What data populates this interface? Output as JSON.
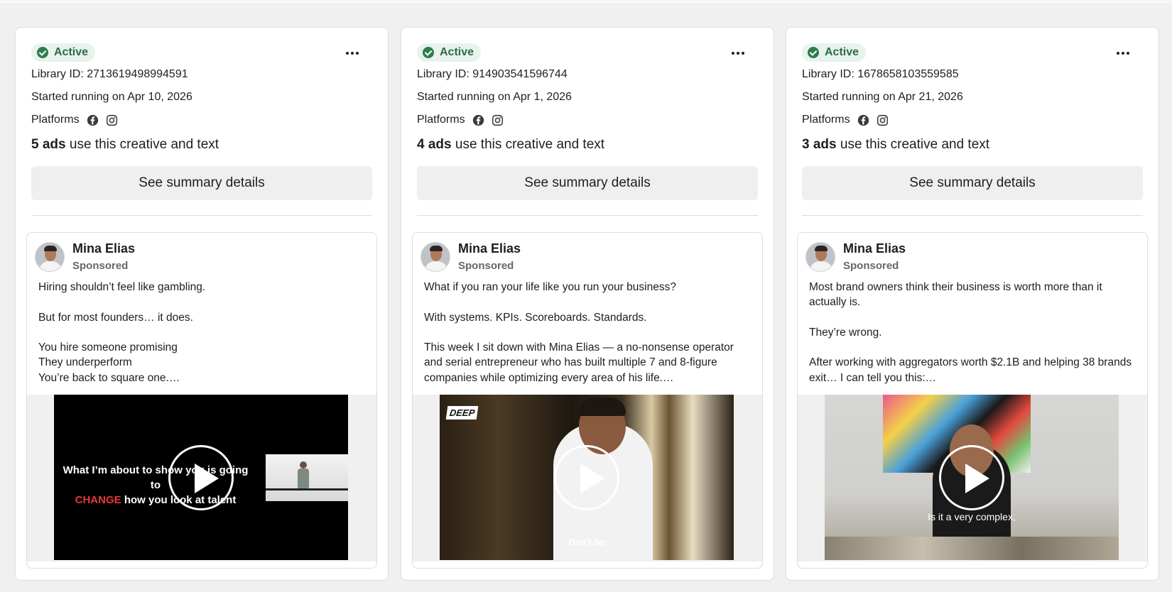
{
  "cards": [
    {
      "status": "Active",
      "library_id": "Library ID: 2713619498994591",
      "started": "Started running on Apr 10, 2026",
      "platforms_label": "Platforms",
      "ads_count": "5 ads",
      "ads_suffix": " use this creative and text",
      "summary_button": "See summary details",
      "advertiser": "Mina Elias",
      "sponsored": "Sponsored",
      "text_lines": [
        "Hiring shouldn’t feel like gambling.",
        "",
        "But for most founders… it does.",
        "",
        "You hire someone promising",
        "They underperform",
        "You’re back to square one.…"
      ],
      "video_caption_1": "What I’m about to show you is going to",
      "video_caption_2a": "CHANGE",
      "video_caption_2b": " how you look at talent"
    },
    {
      "status": "Active",
      "library_id": "Library ID: 914903541596744",
      "started": "Started running on Apr 1, 2026",
      "platforms_label": "Platforms",
      "ads_count": "4 ads",
      "ads_suffix": " use this creative and text",
      "summary_button": "See summary details",
      "advertiser": "Mina Elias",
      "sponsored": "Sponsored",
      "text_lines": [
        "What if you ran your life like you run your business?",
        "",
        "With systems. KPIs. Scoreboards. Standards.",
        "",
        "This week I sit down with Mina Elias — a no-nonsense operator and serial entrepreneur who has built multiple 7 and 8-figure companies while optimizing every area of his life.…"
      ],
      "video_logo": "DEEP",
      "video_caption": "Don't be"
    },
    {
      "status": "Active",
      "library_id": "Library ID: 1678658103559585",
      "started": "Started running on Apr 21, 2026",
      "platforms_label": "Platforms",
      "ads_count": "3 ads",
      "ads_suffix": " use this creative and text",
      "summary_button": "See summary details",
      "advertiser": "Mina Elias",
      "sponsored": "Sponsored",
      "text_lines": [
        "Most brand owners think their business is worth more than it actually is.",
        "",
        "They’re wrong.",
        "",
        "After working with aggregators worth $2.1B and helping 38 brands exit… I can tell you this:…"
      ],
      "video_caption": "Is it a very complex,"
    }
  ],
  "colors": {
    "page_bg": "#f0f0f0",
    "active_badge_bg": "#e7f3ec",
    "active_text": "#2e6b45",
    "button_bg": "#efefef",
    "highlight_red": "#e53935"
  },
  "icons": [
    "check-circle-icon",
    "more-options-icon",
    "facebook-icon",
    "instagram-icon",
    "play-icon"
  ]
}
